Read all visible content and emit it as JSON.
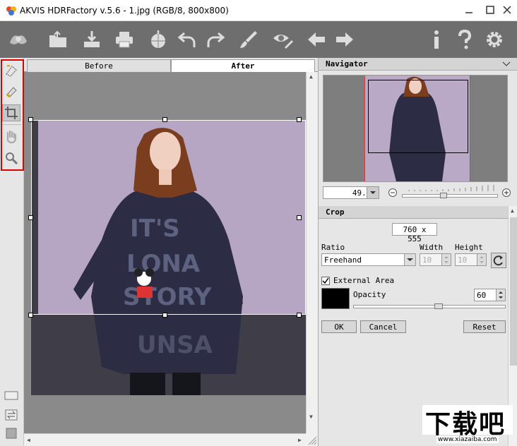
{
  "window": {
    "title": "AKVIS HDRFactory v.5.6 - 1.jpg (RGB/8, 800x800)"
  },
  "toolbar": {
    "buttons": [
      "logo",
      "open",
      "save",
      "print",
      "share",
      "undo",
      "redo",
      "run",
      "preview",
      "back",
      "forward",
      "info",
      "help",
      "settings"
    ]
  },
  "left_tools": [
    "fill-tool",
    "eraser-tool",
    "crop-tool",
    "hand-tool",
    "zoom-tool"
  ],
  "tabs": {
    "before": "Before",
    "after": "After"
  },
  "navigator": {
    "title": "Navigator",
    "zoom": "49.9%"
  },
  "crop": {
    "title": "Crop",
    "size": "760 x 555",
    "ratio_label": "Ratio",
    "ratio_value": "Freehand",
    "width_label": "Width",
    "width_value": "10",
    "height_label": "Height",
    "height_value": "10",
    "external_area_label": "External Area",
    "external_area_checked": true,
    "opacity_label": "Opacity",
    "opacity_value": "60",
    "ok": "OK",
    "cancel": "Cancel",
    "reset": "Reset"
  },
  "watermark": {
    "brand": "下载吧",
    "url": "www.xiazaiba.com"
  },
  "colors": {
    "toolbar_bg": "#6e6e6e",
    "highlight": "#e00000",
    "panel_bg": "#e6e6e6"
  }
}
